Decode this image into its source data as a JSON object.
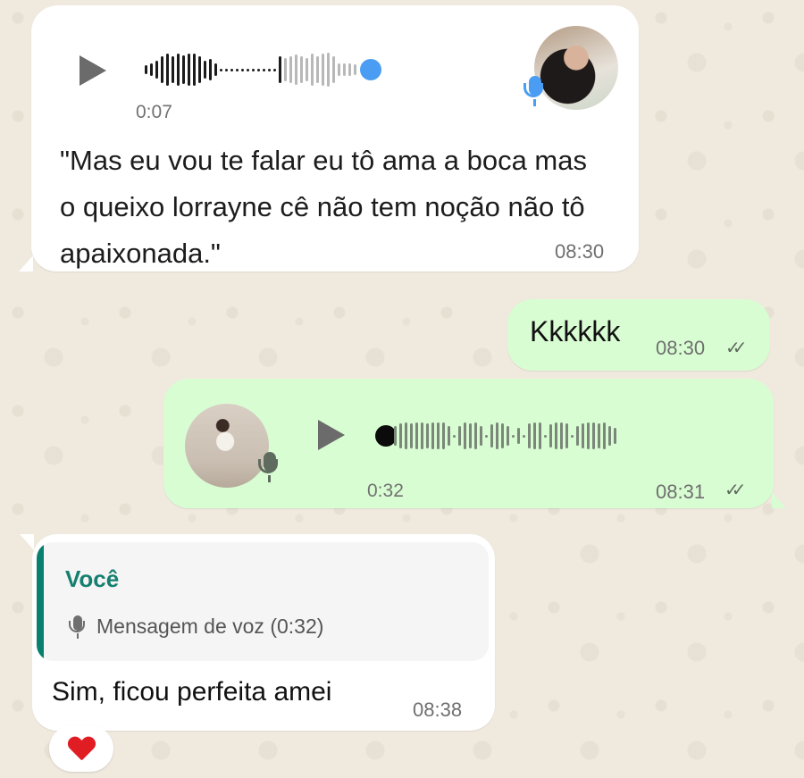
{
  "colors": {
    "incoming_bubble": "#ffffff",
    "outgoing_bubble": "#d9fdd3",
    "accent_blue": "#4a9df2",
    "quote_accent": "#08806f",
    "heart": "#e11d24"
  },
  "messages": {
    "incoming_voice": {
      "duration": "0:07",
      "transcript": "\"Mas eu vou te falar eu tô ama a boca mas o queixo lorrayne cê não tem noção não tô apaixonada.\"",
      "time": "08:30",
      "progress_fraction": 0.45
    },
    "outgoing_text": {
      "text": "Kkkkkk",
      "time": "08:30",
      "status": "read"
    },
    "outgoing_voice": {
      "duration": "0:32",
      "time": "08:31",
      "status": "read",
      "progress_fraction": 0
    },
    "reply": {
      "quoted_author": "Você",
      "quoted_text": "Mensagem de voz (0:32)",
      "text": "Sim, ficou perfeita amei",
      "time": "08:38",
      "reaction": "heart"
    }
  },
  "ticks": "✓✓"
}
